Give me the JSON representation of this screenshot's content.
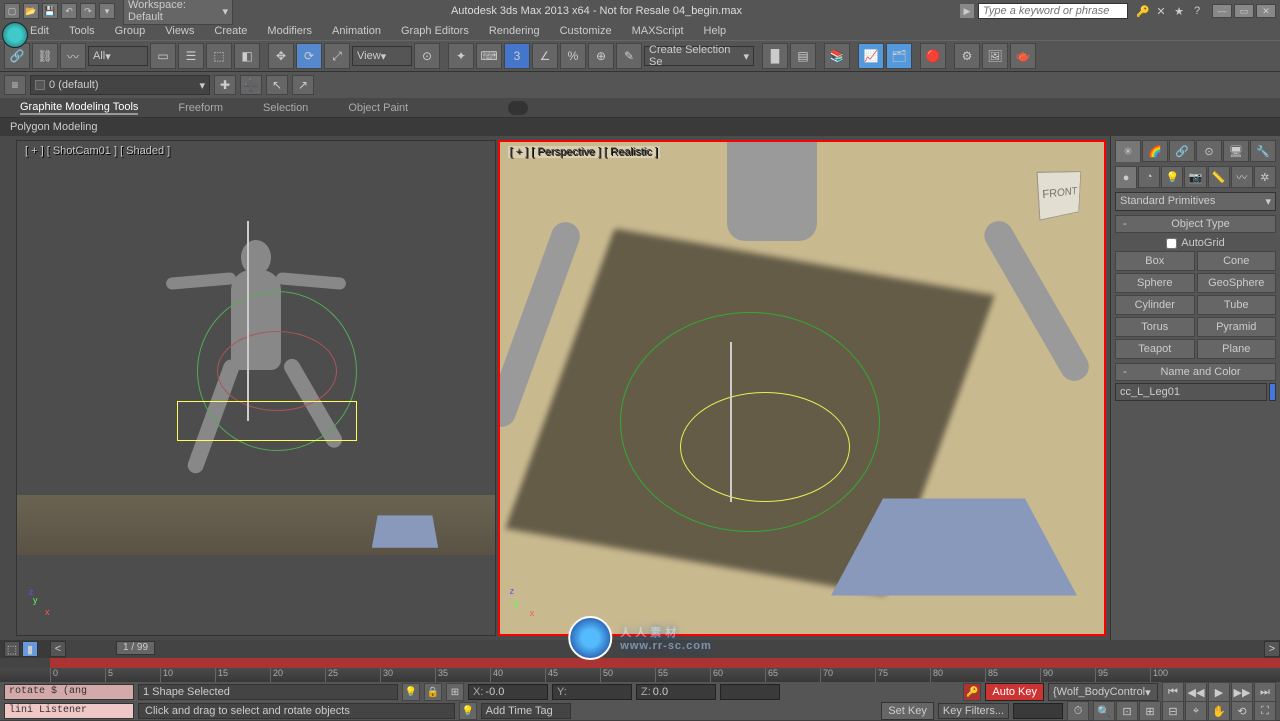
{
  "titlebar": {
    "workspace_label": "Workspace: Default",
    "title": "Autodesk 3ds Max 2013 x64 - Not for Resale   04_begin.max",
    "search_placeholder": "Type a keyword or phrase"
  },
  "menubar": [
    "Edit",
    "Tools",
    "Group",
    "Views",
    "Create",
    "Modifiers",
    "Animation",
    "Graph Editors",
    "Rendering",
    "Customize",
    "MAXScript",
    "Help"
  ],
  "main_toolbar": {
    "filter_dropdown": "All",
    "ref_coord": "View",
    "named_sel": "Create Selection Se"
  },
  "layer_toolbar": {
    "layer_dropdown": "0 (default)"
  },
  "ribbon": {
    "tabs": [
      "Graphite Modeling Tools",
      "Freeform",
      "Selection",
      "Object Paint"
    ],
    "active_tab": 0,
    "sub_panel": "Polygon Modeling"
  },
  "viewports": {
    "left_label": "[ + ] [ ShotCam01 ] [ Shaded ]",
    "right_label": "[ + ] [ Perspective ] [ Realistic ]",
    "viewcube_face": "FRONT"
  },
  "command_panel": {
    "dropdown": "Standard Primitives",
    "rollout_object_type": "Object Type",
    "autogrid_label": "AutoGrid",
    "primitives": [
      "Box",
      "Cone",
      "Sphere",
      "GeoSphere",
      "Cylinder",
      "Tube",
      "Torus",
      "Pyramid",
      "Teapot",
      "Plane"
    ],
    "rollout_name": "Name and Color",
    "object_name": "cc_L_Leg01"
  },
  "timeline": {
    "frame_display": "1 / 99",
    "ruler_ticks": [
      "0",
      "5",
      "10",
      "15",
      "20",
      "25",
      "30",
      "35",
      "40",
      "45",
      "50",
      "55",
      "60",
      "65",
      "70",
      "75",
      "80",
      "85",
      "90",
      "95",
      "100"
    ]
  },
  "status": {
    "selection_text": "1 Shape Selected",
    "x_val": "-0.0",
    "y_val": "",
    "z_val": "0.0",
    "grid_val": "",
    "autokey": "Auto Key",
    "setkey": "Set Key",
    "controller_dropdown": "{Wolf_BodyControl",
    "key_filters": "Key Filters...",
    "listener1": "rotate $ (ang",
    "listener2": "lini Listener",
    "hint": "Click and drag to select and rotate objects",
    "add_tag": "Add Time Tag"
  },
  "watermark": {
    "text": "人人素材",
    "url": "www.rr-sc.com"
  }
}
